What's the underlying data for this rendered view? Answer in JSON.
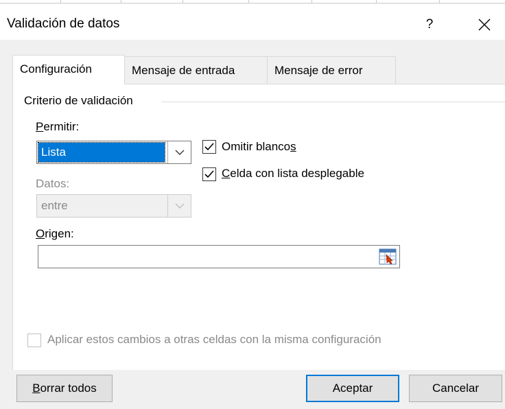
{
  "window": {
    "title": "Validación de datos",
    "help_label": "?",
    "close_label": "×"
  },
  "tabs": [
    {
      "label": "Configuración",
      "active": true
    },
    {
      "label": "Mensaje de entrada",
      "active": false
    },
    {
      "label": "Mensaje de error",
      "active": false
    }
  ],
  "settings": {
    "group_label": "Criterio de validación",
    "allow": {
      "label_prefix": "",
      "label_accel": "P",
      "label_rest": "ermitir:",
      "value": "Lista"
    },
    "ignore_blank": {
      "label_pre": "Omitir blanco",
      "label_accel": "s",
      "label_post": "",
      "checked": true
    },
    "in_cell_dropdown": {
      "label_accel": "C",
      "label_rest": "elda con lista desplegable",
      "checked": true
    },
    "data": {
      "label": "Datos:",
      "value": "entre",
      "enabled": false
    },
    "source": {
      "label_accel": "O",
      "label_rest": "rigen:",
      "value": ""
    },
    "apply_all": {
      "label": "Aplicar estos cambios a otras celdas con la misma configuración",
      "checked": false,
      "enabled": false
    }
  },
  "footer": {
    "clear_accel": "B",
    "clear_rest": "orrar todos",
    "ok_label": "Aceptar",
    "cancel_label": "Cancelar"
  },
  "colors": {
    "accent": "#0078d7",
    "panel": "#ffffff",
    "dialog_bg": "#f0f0f0"
  }
}
